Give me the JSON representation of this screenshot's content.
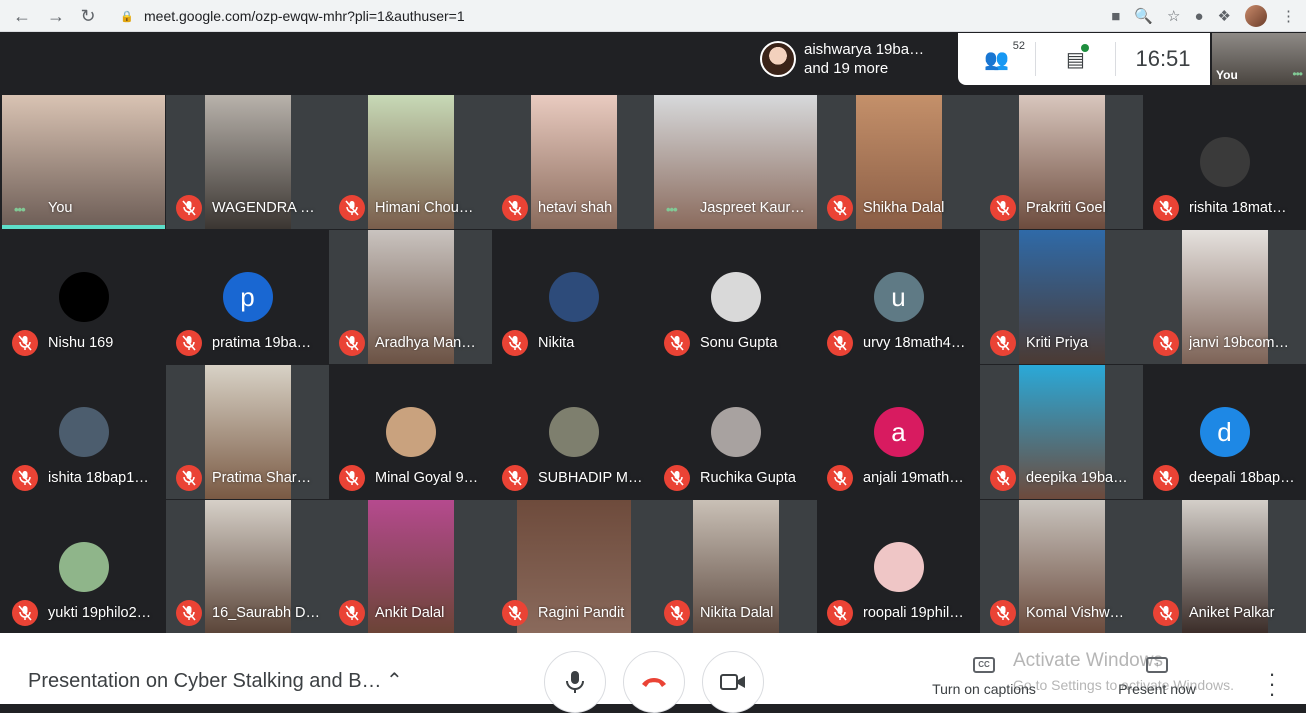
{
  "browser": {
    "url": "meet.google.com/ozp-ewqw-mhr?pli=1&authuser=1"
  },
  "topbar": {
    "presenter_line1": "aishwarya 19ba…",
    "presenter_line2": "and 19 more",
    "people_count": "52",
    "time": "16:51",
    "self_label": "You"
  },
  "participants": [
    {
      "name": "You",
      "muted": false,
      "talking": true
    },
    {
      "name": "WAGENDRA S…",
      "muted": true
    },
    {
      "name": "Himani Chou…",
      "muted": true
    },
    {
      "name": "hetavi shah",
      "muted": true
    },
    {
      "name": "Jaspreet Kaur…",
      "muted": false,
      "talking": true
    },
    {
      "name": "Shikha Dalal",
      "muted": true
    },
    {
      "name": "Prakriti Goel",
      "muted": true
    },
    {
      "name": "rishita 18mat…",
      "muted": true
    },
    {
      "name": "Nishu 169",
      "muted": true
    },
    {
      "name": "pratima 19ba…",
      "muted": true,
      "initial": "p"
    },
    {
      "name": "Aradhya Man…",
      "muted": true
    },
    {
      "name": "Nikita",
      "muted": true
    },
    {
      "name": "Sonu Gupta",
      "muted": true
    },
    {
      "name": "urvy 18math4…",
      "muted": true,
      "initial": "u"
    },
    {
      "name": "Kriti Priya",
      "muted": true
    },
    {
      "name": "janvi 19bcom…",
      "muted": true
    },
    {
      "name": "ishita 18bap1…",
      "muted": true
    },
    {
      "name": "Pratima Shar…",
      "muted": true
    },
    {
      "name": "Minal Goyal 9…",
      "muted": true
    },
    {
      "name": "SUBHADIP M…",
      "muted": true
    },
    {
      "name": "Ruchika Gupta",
      "muted": true
    },
    {
      "name": "anjali 19math…",
      "muted": true,
      "initial": "a"
    },
    {
      "name": "deepika 19ba…",
      "muted": true
    },
    {
      "name": "deepali 18bap…",
      "muted": true,
      "initial": "d"
    },
    {
      "name": "yukti 19philo2…",
      "muted": true
    },
    {
      "name": "16_Saurabh D…",
      "muted": true
    },
    {
      "name": "Ankit Dalal",
      "muted": true
    },
    {
      "name": "Ragini Pandit",
      "muted": true
    },
    {
      "name": "Nikita Dalal",
      "muted": true
    },
    {
      "name": "roopali 19phil…",
      "muted": true
    },
    {
      "name": "Komal Vishw…",
      "muted": true
    },
    {
      "name": "Aniket Palkar",
      "muted": true
    }
  ],
  "bottombar": {
    "meeting_title": "Presentation on Cyber Stalking and B…",
    "captions_label": "Turn on captions",
    "present_label": "Present now",
    "watermark_title": "Activate Windows",
    "watermark_sub": "Go to Settings to activate Windows."
  },
  "colors": {
    "mute_red": "#ea4335",
    "talk_green": "#81c995",
    "speaking_bar": "#5ddec9",
    "avatar_blue": "#1a73e8",
    "avatar_teal_gray": "#5f7a85",
    "avatar_pink": "#d81b60",
    "avatar_sky": "#1e88e5"
  }
}
